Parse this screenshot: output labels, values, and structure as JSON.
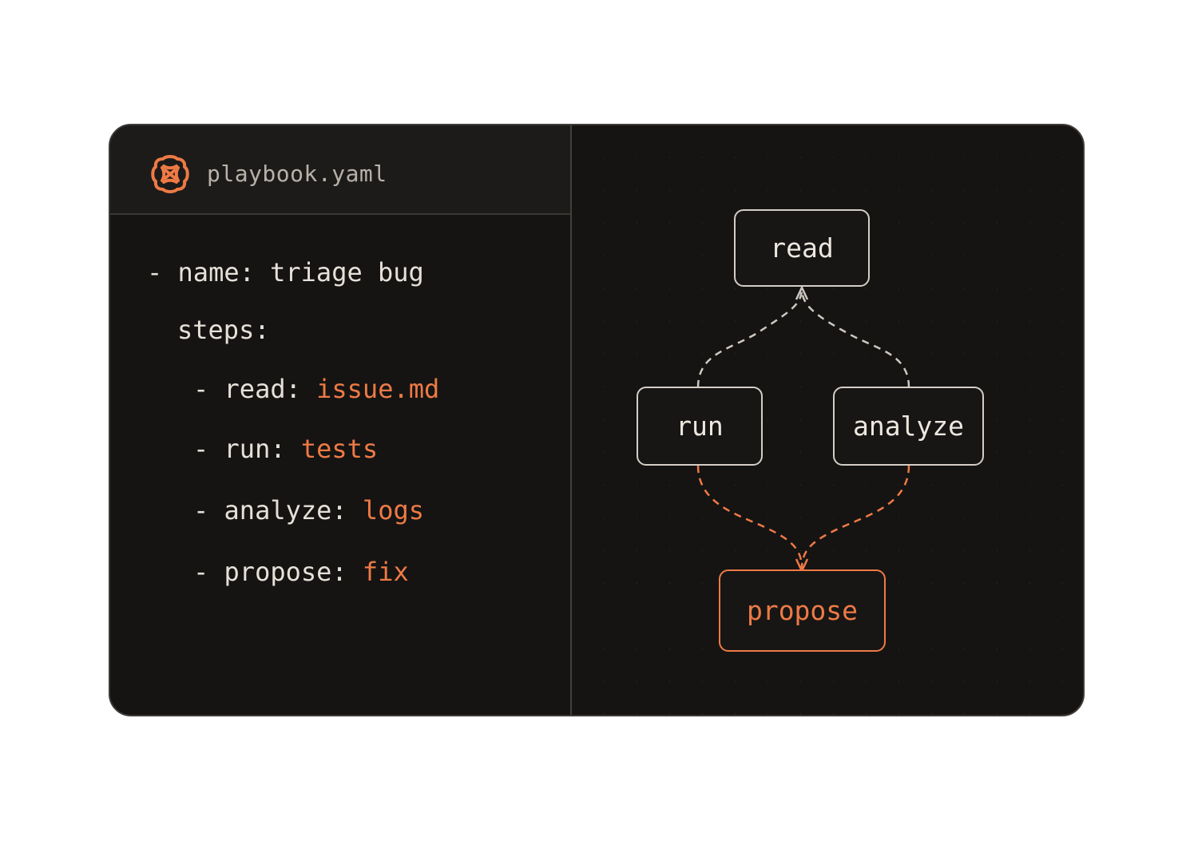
{
  "colors": {
    "background": "#ffffff",
    "panel": "#151413",
    "header": "#1c1b1a",
    "text": "#e6e0d8",
    "accent": "#ee7a45",
    "node_border": "#d5cec6"
  },
  "editor": {
    "logo_icon": "orange-knot-logo-icon",
    "filename": "playbook.yaml",
    "lines": [
      {
        "prefix": "- name: ",
        "key": "",
        "value": "",
        "text": "triage bug"
      },
      {
        "prefix": "steps:",
        "key": "",
        "value": "",
        "text": ""
      },
      {
        "prefix": "- read: ",
        "value": "issue.md"
      },
      {
        "prefix": "- run: ",
        "value": "tests"
      },
      {
        "prefix": "- analyze: ",
        "value": "logs"
      },
      {
        "prefix": "- propose: ",
        "value": "fix"
      }
    ]
  },
  "diagram": {
    "nodes": {
      "read": "read",
      "run": "run",
      "analyze": "analyze",
      "propose": "propose"
    },
    "edges": [
      {
        "from": "run",
        "to": "read",
        "style": "dashed-gray"
      },
      {
        "from": "analyze",
        "to": "read",
        "style": "dashed-gray"
      },
      {
        "from": "run",
        "to": "propose",
        "style": "dashed-orange"
      },
      {
        "from": "analyze",
        "to": "propose",
        "style": "dashed-orange"
      }
    ]
  }
}
